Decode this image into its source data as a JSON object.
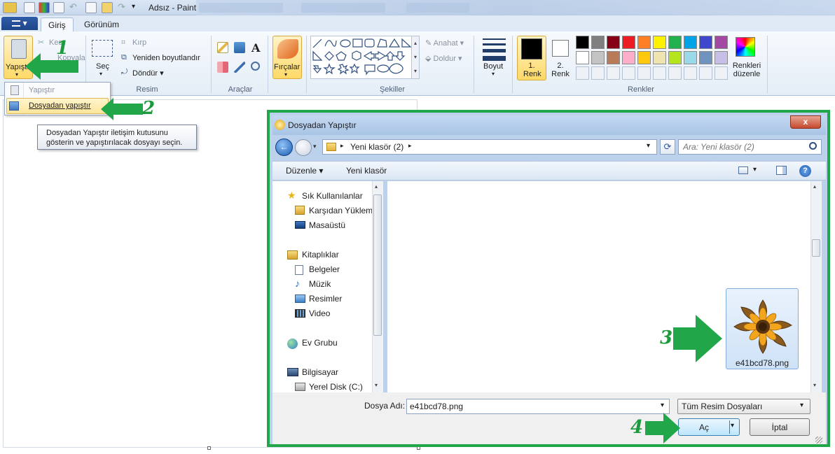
{
  "window": {
    "title": "Adsız - Paint"
  },
  "ribbon_tabs": {
    "file_menu": "▾",
    "home": "Giriş",
    "view": "Görünüm"
  },
  "clipboard": {
    "paste": "Yapıştır",
    "cut": "Kes",
    "copy": "Kopyala"
  },
  "image": {
    "select": "Seç",
    "crop": "Kırp",
    "resize": "Yeniden boyutlandır",
    "rotate": "Döndür",
    "group": "Resim"
  },
  "tools": {
    "group": "Araçlar",
    "text_tool": "A"
  },
  "brushes": {
    "label": "Fırçalar"
  },
  "shapes": {
    "outline": "Anahat",
    "fill": "Doldur",
    "group": "Şekiller"
  },
  "size": {
    "label": "Boyut"
  },
  "colors": {
    "color1": "1. Renk",
    "color2": "2. Renk",
    "edit": "Renkleri düzenle",
    "group": "Renkler",
    "palette_row1": [
      "#000000",
      "#7f7f7f",
      "#880015",
      "#ed1c24",
      "#ff7f27",
      "#fff200",
      "#22b14c",
      "#00a2e8",
      "#3f48cc",
      "#a349a4"
    ],
    "palette_row2": [
      "#ffffff",
      "#c3c3c3",
      "#b97a57",
      "#ffaec9",
      "#ffc90e",
      "#efe4b0",
      "#b5e61d",
      "#99d9ea",
      "#7092be",
      "#c8bfe7"
    ]
  },
  "paste_menu": {
    "item1": "Yapıştır",
    "item2": "Dosyadan yapıştır"
  },
  "tooltip": {
    "line1": "Dosyadan Yapıştır iletişim kutusunu",
    "line2": "gösterin ve yapıştırılacak dosyayı seçin."
  },
  "steps": {
    "s1": "1",
    "s2": "2",
    "s3": "3",
    "s4": "4"
  },
  "dialog": {
    "title": "Dosyadan Yapıştır",
    "close": "x",
    "breadcrumb": "Yeni klasör (2)",
    "search_placeholder": "Ara: Yeni klasör (2)",
    "organize": "Düzenle",
    "new_folder": "Yeni klasör",
    "help": "?",
    "nav": {
      "favorites": "Sık Kullanılanlar",
      "downloads": "Karşıdan Yüklem",
      "desktop": "Masaüstü",
      "libraries": "Kitaplıklar",
      "documents": "Belgeler",
      "music": "Müzik",
      "pictures": "Resimler",
      "video": "Video",
      "homegroup": "Ev Grubu",
      "computer": "Bilgisayar",
      "local_disk": "Yerel Disk (C:)"
    },
    "file": {
      "name": "e41bcd78.png"
    },
    "filename_label": "Dosya Adı:",
    "filename_value": "e41bcd78.png",
    "filetype": "Tüm Resim Dosyaları",
    "open": "Aç",
    "cancel": "İptal"
  }
}
